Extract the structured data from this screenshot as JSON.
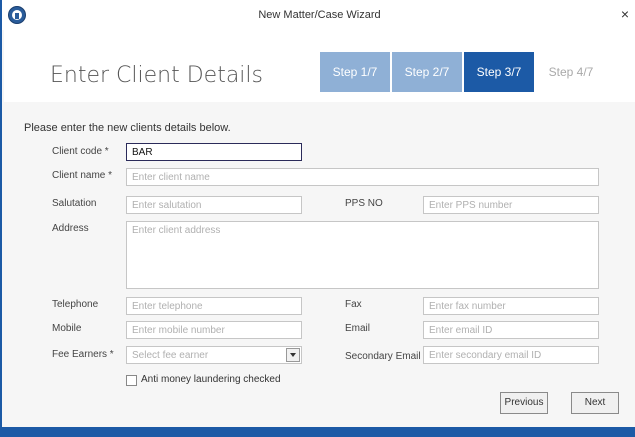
{
  "window": {
    "title": "New Matter/Case Wizard",
    "close": "×"
  },
  "header": {
    "title": "Enter Client Details",
    "steps": [
      {
        "label": "Step 1/7",
        "state": "done"
      },
      {
        "label": "Step 2/7",
        "state": "done"
      },
      {
        "label": "Step 3/7",
        "state": "current"
      },
      {
        "label": "Step 4/7",
        "state": "next"
      }
    ]
  },
  "form": {
    "intro": "Please enter the new clients details below.",
    "client_code": {
      "label": "Client code *",
      "value": "BAR"
    },
    "client_name": {
      "label": "Client name *",
      "placeholder": "Enter client name"
    },
    "salutation": {
      "label": "Salutation",
      "placeholder": "Enter salutation"
    },
    "pps_no": {
      "label": "PPS NO",
      "placeholder": "Enter PPS number"
    },
    "address": {
      "label": "Address",
      "placeholder": "Enter client address"
    },
    "telephone": {
      "label": "Telephone",
      "placeholder": "Enter telephone"
    },
    "fax": {
      "label": "Fax",
      "placeholder": "Enter fax number"
    },
    "mobile": {
      "label": "Mobile",
      "placeholder": "Enter mobile number"
    },
    "email": {
      "label": "Email",
      "placeholder": "Enter email ID"
    },
    "fee_earners": {
      "label": "Fee Earners *",
      "placeholder": "Select fee earner"
    },
    "secondary_email": {
      "label": "Secondary Email",
      "placeholder": "Enter secondary email ID"
    },
    "aml_checkbox": {
      "label": "Anti money laundering checked",
      "checked": false
    }
  },
  "footer": {
    "previous_label": "Previous",
    "next_label": "Next"
  },
  "colors": {
    "accent": "#1c5aa6",
    "step_done": "#8fb0d6",
    "step_next_text": "#a9a9a9"
  }
}
